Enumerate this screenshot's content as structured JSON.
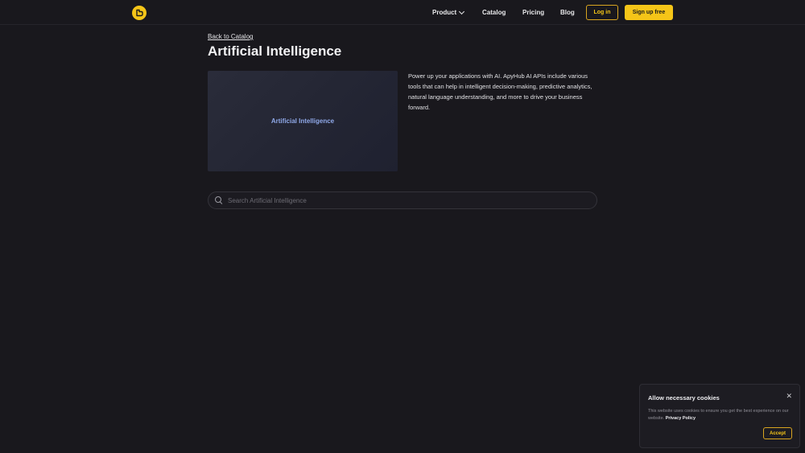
{
  "header": {
    "logo_icon": "apyhub-logo-icon",
    "nav": {
      "product": "Product",
      "catalog": "Catalog",
      "pricing": "Pricing",
      "blog": "Blog"
    },
    "login_label": "Log in",
    "signup_label": "Sign up free",
    "accent_color": "#f5c518"
  },
  "main": {
    "back_link": "Back to Catalog",
    "title": "Artificial Intelligence",
    "hero_label": "Artificial Intelligence",
    "description": "Power up your applications with AI. ApyHub AI APIs include various tools that can help in intelligent decision-making, predictive analytics, natural language understanding, and more to drive your business forward.",
    "search": {
      "placeholder": "Search Artificial Intelligence",
      "value": ""
    }
  },
  "cookie_banner": {
    "title": "Allow necessary cookies",
    "close_icon": "close-icon",
    "text": "This website uses cookies to ensure you get the best experience on our website.",
    "link": "Privacy Policy",
    "accept_label": "Accept"
  }
}
